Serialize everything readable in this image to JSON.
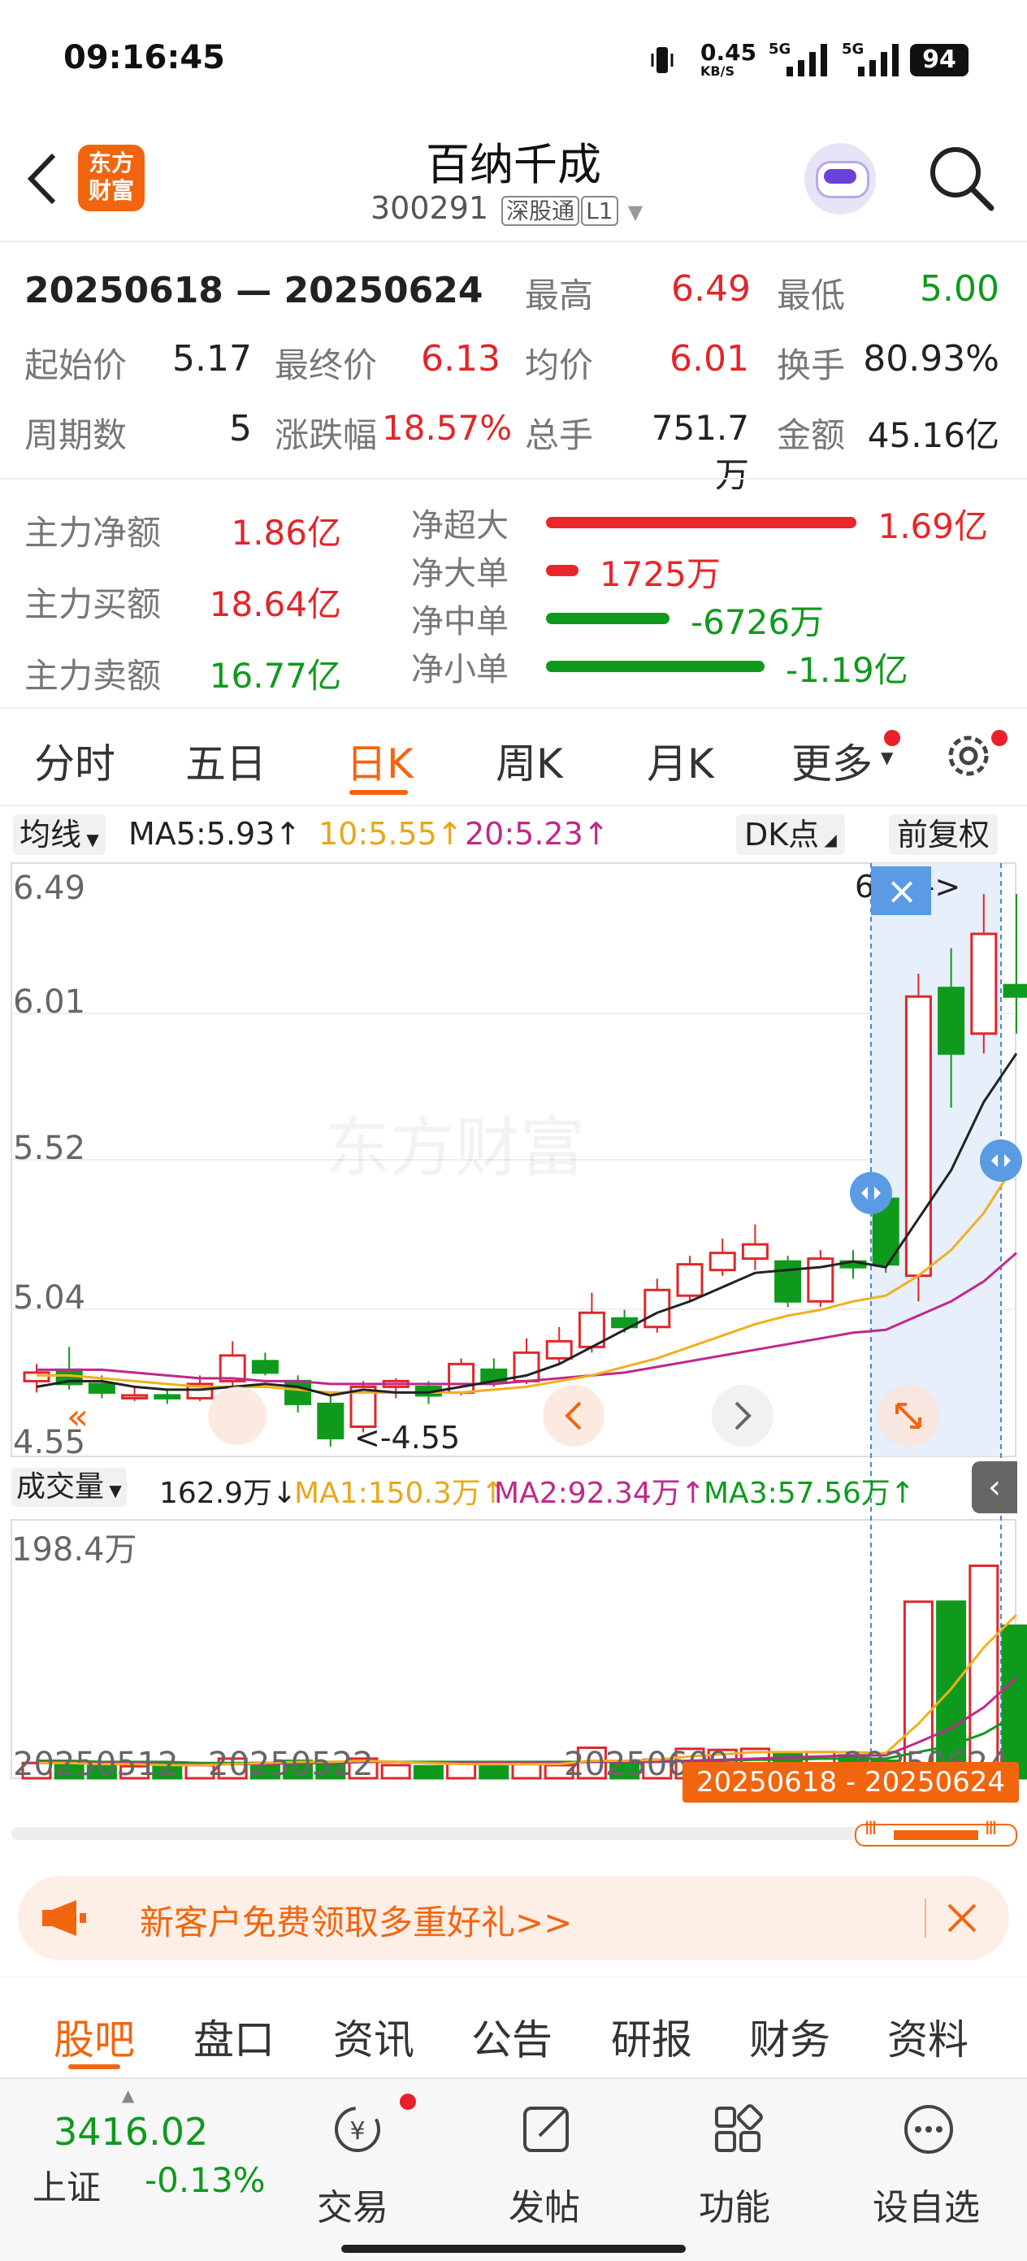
{
  "status": {
    "time": "09:16:45",
    "speed": "0.45",
    "speed_unit": "KB/S",
    "net1": "5G",
    "net2": "5G",
    "battery": "94"
  },
  "header": {
    "logo": "东方财富",
    "title": "百纳千成",
    "code": "300291",
    "market": "深股通",
    "level": "L1"
  },
  "stats": {
    "range": "20250618 — 20250624",
    "high_label": "最高",
    "high": "6.49",
    "low_label": "最低",
    "low": "5.00",
    "open_label": "起始价",
    "open": "5.17",
    "close_label": "最终价",
    "close": "6.13",
    "avg_label": "均价",
    "avg": "6.01",
    "turnover_label": "换手",
    "turnover": "80.93%",
    "days_label": "周期数",
    "days": "5",
    "change_label": "涨跌幅",
    "change": "18.57%",
    "volume_label": "总手",
    "volume": "751.7万",
    "amount_label": "金额",
    "amount": "45.16亿"
  },
  "flow": {
    "net_label": "主力净额",
    "net": "1.86亿",
    "buy_label": "主力买额",
    "buy": "18.64亿",
    "sell_label": "主力卖额",
    "sell": "16.77亿",
    "bars": [
      {
        "label": "净超大",
        "value": "1.69亿",
        "amount": 1.69,
        "color": "#e8262b"
      },
      {
        "label": "净大单",
        "value": "1725万",
        "amount": 0.1725,
        "color": "#e8262b"
      },
      {
        "label": "净中单",
        "value": "-6726万",
        "amount": -0.6726,
        "color": "#0f9a1d"
      },
      {
        "label": "净小单",
        "value": "-1.19亿",
        "amount": -1.19,
        "color": "#0f9a1d"
      }
    ]
  },
  "tabs": {
    "t1": "分时",
    "t2": "五日",
    "t3": "日K",
    "t4": "周K",
    "t5": "月K",
    "t6": "更多"
  },
  "ma_bar": {
    "select": "均线",
    "ma5": "MA5:5.93↑",
    "ma10": "10:5.55↑",
    "ma20": "20:5.23↑",
    "dk": "DK点",
    "fq": "前复权"
  },
  "price_axis": {
    "p1": "6.49",
    "p2": "6.01",
    "p3": "5.52",
    "p4": "5.04",
    "p5": "4.55"
  },
  "annotations": {
    "high": "6.49->",
    "low": "<-4.55",
    "watermark": "东方财富"
  },
  "vol_bar": {
    "select": "成交量",
    "vol": "162.9万↓",
    "ma1": "MA1:150.3万↑",
    "ma2": "MA2:92.34万↑",
    "ma3": "MA3:57.56万↑",
    "max": "198.4万"
  },
  "dates": {
    "d1": "20250512",
    "d2": "20250522",
    "d3": "20250609",
    "d4": "20250624",
    "selected_range": "20250618 - 20250624"
  },
  "banner": {
    "text": "新客户免费领取多重好礼>>"
  },
  "subtabs": {
    "s1": "股吧",
    "s2": "盘口",
    "s3": "资讯",
    "s4": "公告",
    "s5": "研报",
    "s6": "财务",
    "s7": "资料"
  },
  "bottom": {
    "index_value": "3416.02",
    "index_name": "上证",
    "index_change": "-0.13%",
    "b1": "交易",
    "b2": "发帖",
    "b3": "功能",
    "b4": "设自选"
  },
  "colors": {
    "up": "#e0262a",
    "down": "#0f9a1d",
    "accent": "#f2650f",
    "ma5": "#222222",
    "ma10": "#f0b01e",
    "ma20": "#c0288a"
  },
  "chart_data": {
    "type": "candlestick",
    "price_range": [
      4.55,
      6.49
    ],
    "volume_max": "198.4万",
    "candles": [
      {
        "o": 4.78,
        "c": 4.81,
        "h": 4.84,
        "l": 4.74,
        "v": 14
      },
      {
        "o": 4.82,
        "c": 4.77,
        "h": 4.9,
        "l": 4.75,
        "v": 13
      },
      {
        "o": 4.77,
        "c": 4.74,
        "h": 4.8,
        "l": 4.72,
        "v": 12
      },
      {
        "o": 4.72,
        "c": 4.73,
        "h": 4.76,
        "l": 4.71,
        "v": 11
      },
      {
        "o": 4.73,
        "c": 4.72,
        "h": 4.75,
        "l": 4.7,
        "v": 12
      },
      {
        "o": 4.72,
        "c": 4.77,
        "h": 4.8,
        "l": 4.71,
        "v": 12
      },
      {
        "o": 4.78,
        "c": 4.87,
        "h": 4.92,
        "l": 4.76,
        "v": 18
      },
      {
        "o": 4.85,
        "c": 4.81,
        "h": 4.88,
        "l": 4.8,
        "v": 14
      },
      {
        "o": 4.78,
        "c": 4.7,
        "h": 4.8,
        "l": 4.67,
        "v": 16
      },
      {
        "o": 4.7,
        "c": 4.58,
        "h": 4.73,
        "l": 4.55,
        "v": 15
      },
      {
        "o": 4.62,
        "c": 4.76,
        "h": 4.78,
        "l": 4.6,
        "v": 18
      },
      {
        "o": 4.76,
        "c": 4.78,
        "h": 4.79,
        "l": 4.72,
        "v": 12
      },
      {
        "o": 4.76,
        "c": 4.73,
        "h": 4.78,
        "l": 4.7,
        "v": 11
      },
      {
        "o": 4.74,
        "c": 4.84,
        "h": 4.86,
        "l": 4.73,
        "v": 14
      },
      {
        "o": 4.82,
        "c": 4.78,
        "h": 4.86,
        "l": 4.76,
        "v": 13
      },
      {
        "o": 4.78,
        "c": 4.88,
        "h": 4.93,
        "l": 4.77,
        "v": 13
      },
      {
        "o": 4.86,
        "c": 4.92,
        "h": 4.97,
        "l": 4.84,
        "v": 12
      },
      {
        "o": 4.9,
        "c": 5.02,
        "h": 5.09,
        "l": 4.88,
        "v": 28
      },
      {
        "o": 5.0,
        "c": 4.97,
        "h": 5.03,
        "l": 4.95,
        "v": 14
      },
      {
        "o": 4.97,
        "c": 5.1,
        "h": 5.14,
        "l": 4.95,
        "v": 17
      },
      {
        "o": 5.08,
        "c": 5.19,
        "h": 5.22,
        "l": 5.06,
        "v": 27
      },
      {
        "o": 5.17,
        "c": 5.23,
        "h": 5.28,
        "l": 5.15,
        "v": 26
      },
      {
        "o": 5.21,
        "c": 5.26,
        "h": 5.33,
        "l": 5.17,
        "v": 27
      },
      {
        "o": 5.2,
        "c": 5.06,
        "h": 5.22,
        "l": 5.04,
        "v": 22
      },
      {
        "o": 5.06,
        "c": 5.21,
        "h": 5.24,
        "l": 5.04,
        "v": 24
      },
      {
        "o": 5.2,
        "c": 5.18,
        "h": 5.24,
        "l": 5.14,
        "v": 21
      },
      {
        "o": 5.42,
        "c": 5.19,
        "h": 5.48,
        "l": 5.16,
        "v": 16
      },
      {
        "o": 5.15,
        "c": 6.13,
        "h": 6.21,
        "l": 5.06,
        "v": 162
      },
      {
        "o": 6.16,
        "c": 5.93,
        "h": 6.3,
        "l": 5.74,
        "v": 162
      },
      {
        "o": 6.0,
        "c": 6.35,
        "h": 6.49,
        "l": 5.93,
        "v": 195
      },
      {
        "o": 6.17,
        "c": 6.13,
        "h": 6.49,
        "l": 6.0,
        "v": 140
      }
    ],
    "ma5": [
      4.76,
      4.78,
      4.78,
      4.76,
      4.75,
      4.75,
      4.76,
      4.77,
      4.76,
      4.73,
      4.75,
      4.74,
      4.74,
      4.76,
      4.78,
      4.8,
      4.84,
      4.9,
      4.96,
      5.02,
      5.06,
      5.11,
      5.16,
      5.17,
      5.18,
      5.2,
      5.18,
      5.35,
      5.52,
      5.76,
      5.93
    ],
    "ma10": [
      4.8,
      4.8,
      4.79,
      4.78,
      4.77,
      4.76,
      4.76,
      4.76,
      4.75,
      4.74,
      4.74,
      4.74,
      4.74,
      4.74,
      4.75,
      4.76,
      4.78,
      4.8,
      4.83,
      4.86,
      4.9,
      4.94,
      4.98,
      5.01,
      5.03,
      5.06,
      5.08,
      5.15,
      5.24,
      5.37,
      5.55
    ],
    "ma20": [
      4.82,
      4.82,
      4.82,
      4.81,
      4.8,
      4.79,
      4.79,
      4.78,
      4.78,
      4.77,
      4.77,
      4.77,
      4.77,
      4.77,
      4.77,
      4.78,
      4.79,
      4.8,
      4.81,
      4.83,
      4.85,
      4.87,
      4.89,
      4.91,
      4.93,
      4.95,
      4.96,
      5.01,
      5.06,
      5.13,
      5.23
    ],
    "vma1": [
      14,
      14,
      13,
      13,
      12,
      12,
      13,
      14,
      15,
      15,
      16,
      15,
      14,
      13,
      13,
      13,
      13,
      16,
      16,
      17,
      20,
      22,
      24,
      24,
      24,
      24,
      23,
      50,
      82,
      120,
      150
    ],
    "vma2": [
      15,
      15,
      14,
      14,
      13,
      13,
      13,
      13,
      14,
      14,
      15,
      15,
      14,
      14,
      14,
      14,
      14,
      15,
      15,
      15,
      16,
      17,
      18,
      19,
      20,
      21,
      21,
      33,
      46,
      65,
      92
    ],
    "vma3": [
      16,
      16,
      15,
      15,
      15,
      14,
      14,
      14,
      14,
      14,
      15,
      15,
      15,
      15,
      15,
      15,
      15,
      15,
      15,
      15,
      16,
      16,
      17,
      17,
      18,
      18,
      18,
      24,
      30,
      41,
      58
    ]
  }
}
